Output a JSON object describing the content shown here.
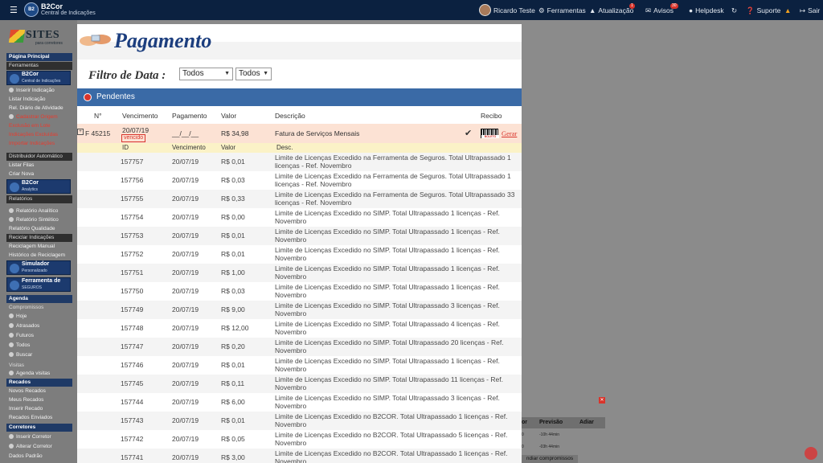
{
  "topbar": {
    "brand": "B2Cor",
    "brand_sub": "Central de Indicações",
    "user": "Ricardo Teste",
    "items": [
      {
        "label": "Ferramentas"
      },
      {
        "label": "Atualização",
        "badge": "1"
      },
      {
        "label": "Avisos",
        "badge": "30"
      },
      {
        "label": "Helpdesk"
      },
      {
        "label": "Suporte"
      },
      {
        "label": "Sair"
      }
    ]
  },
  "sidebar": {
    "logo": "SITES",
    "logo_sub": "para corretores",
    "items": [
      "Página Principal",
      "Ferramentas",
      "Inserir Indicação",
      "Listar Indicação",
      "Rel. Diário de Atividade",
      "Cadastrar Origem",
      "Exclusão em Lote",
      "Indicações Excluídas",
      "Importar Indicações",
      "Distribuidor Automático",
      "Listar Filas",
      "Criar Nova",
      "Relatórios",
      "Relatório Analítico",
      "Relatório Sintético",
      "Relatório Qualidade",
      "Reciclar Indicações",
      "Reciclagem Manual",
      "Histórico de Reciclagem",
      "Agenda",
      "Compromissos",
      "Hoje",
      "Atrasados",
      "Futuros",
      "Todos",
      "Buscar",
      "Visitas",
      "Agenda visitas",
      "Recados",
      "Novos Recados",
      "Meus Recados",
      "Inserir Recado",
      "Recados Enviados",
      "Corretores",
      "Inserir Corretor",
      "Alterar Corretor",
      "Dados Padrão"
    ],
    "banners": {
      "b2cor": "B2Cor",
      "b2cor_sub": "Central de Indicações",
      "analytics": "B2Cor",
      "analytics_sub": "Analytics",
      "simulador": "Simulador",
      "simulador_sub": "Personalizado",
      "seguros": "Ferramenta de",
      "seguros_sub": "SEGUROS"
    }
  },
  "background": {
    "headers": [
      "or",
      "Previsão",
      "Adiar"
    ],
    "rows": [
      {
        "a": "0",
        "b": "-10h 44min"
      },
      {
        "a": "0",
        "b": "-03h 44min"
      }
    ],
    "strip": "ndiar compromissos"
  },
  "modal": {
    "title": "Pagamento",
    "filter_label": "Filtro de Data :",
    "filter1": "Todos",
    "filter2": "Todos",
    "section": "Pendentes",
    "columns": {
      "num": "N°",
      "venc": "Vencimento",
      "pag": "Pagamento",
      "valor": "Valor",
      "desc": "Descrição",
      "recibo": "Recibo"
    },
    "invoice": {
      "expand": "+",
      "num": "F 45215",
      "venc": "20/07/19",
      "status": "vencido",
      "pag": "__/__/__",
      "valor": "R$ 34,98",
      "desc": "Fatura de Serviços Mensais",
      "barcode_label": "BOLETO",
      "gerar": "Gerar"
    },
    "sub_columns": {
      "id": "ID",
      "venc": "Vencimento",
      "valor": "Valor",
      "desc": "Desc."
    },
    "items": [
      {
        "id": "157757",
        "date": "20/07/19",
        "value": "R$ 0,01",
        "desc": "Limite de Licenças Excedido na Ferramenta de Seguros. Total Ultrapassado 1 licenças - Ref. Novembro"
      },
      {
        "id": "157756",
        "date": "20/07/19",
        "value": "R$ 0,03",
        "desc": "Limite de Licenças Excedido na Ferramenta de Seguros. Total Ultrapassado 1 licenças - Ref. Novembro"
      },
      {
        "id": "157755",
        "date": "20/07/19",
        "value": "R$ 0,33",
        "desc": "Limite de Licenças Excedido na Ferramenta de Seguros. Total Ultrapassado 33 licenças - Ref. Novembro"
      },
      {
        "id": "157754",
        "date": "20/07/19",
        "value": "R$ 0,00",
        "desc": "Limite de Licenças Excedido no SIMP. Total Ultrapassado 1 licenças - Ref. Novembro"
      },
      {
        "id": "157753",
        "date": "20/07/19",
        "value": "R$ 0,01",
        "desc": "Limite de Licenças Excedido no SIMP. Total Ultrapassado 1 licenças - Ref. Novembro"
      },
      {
        "id": "157752",
        "date": "20/07/19",
        "value": "R$ 0,01",
        "desc": "Limite de Licenças Excedido no SIMP. Total Ultrapassado 1 licenças - Ref. Novembro"
      },
      {
        "id": "157751",
        "date": "20/07/19",
        "value": "R$ 1,00",
        "desc": "Limite de Licenças Excedido no SIMP. Total Ultrapassado 1 licenças - Ref. Novembro"
      },
      {
        "id": "157750",
        "date": "20/07/19",
        "value": "R$ 0,03",
        "desc": "Limite de Licenças Excedido no SIMP. Total Ultrapassado 1 licenças - Ref. Novembro"
      },
      {
        "id": "157749",
        "date": "20/07/19",
        "value": "R$ 9,00",
        "desc": "Limite de Licenças Excedido no SIMP. Total Ultrapassado 3 licenças - Ref. Novembro"
      },
      {
        "id": "157748",
        "date": "20/07/19",
        "value": "R$ 12,00",
        "desc": "Limite de Licenças Excedido no SIMP. Total Ultrapassado 4 licenças - Ref. Novembro"
      },
      {
        "id": "157747",
        "date": "20/07/19",
        "value": "R$ 0,20",
        "desc": "Limite de Licenças Excedido no SIMP. Total Ultrapassado 20 licenças - Ref. Novembro"
      },
      {
        "id": "157746",
        "date": "20/07/19",
        "value": "R$ 0,01",
        "desc": "Limite de Licenças Excedido no SIMP. Total Ultrapassado 1 licenças - Ref. Novembro"
      },
      {
        "id": "157745",
        "date": "20/07/19",
        "value": "R$ 0,11",
        "desc": "Limite de Licenças Excedido no SIMP. Total Ultrapassado 11 licenças - Ref. Novembro"
      },
      {
        "id": "157744",
        "date": "20/07/19",
        "value": "R$ 6,00",
        "desc": "Limite de Licenças Excedido no SIMP. Total Ultrapassado 3 licenças - Ref. Novembro"
      },
      {
        "id": "157743",
        "date": "20/07/19",
        "value": "R$ 0,01",
        "desc": "Limite de Licenças Excedido no B2COR. Total Ultrapassado 1 licenças - Ref. Novembro"
      },
      {
        "id": "157742",
        "date": "20/07/19",
        "value": "R$ 0,05",
        "desc": "Limite de Licenças Excedido no B2COR. Total Ultrapassado 5 licenças - Ref. Novembro"
      },
      {
        "id": "157741",
        "date": "20/07/19",
        "value": "R$ 3,00",
        "desc": "Limite de Licenças Excedido no B2COR. Total Ultrapassado 1 licenças - Ref. Novembro"
      }
    ]
  },
  "colors": {
    "topbar": "#0b2140",
    "section_bar": "#3a6aa6",
    "title": "#1c3e7e",
    "invoice_row": "#fce2d4",
    "alert_red": "#d9342b"
  }
}
